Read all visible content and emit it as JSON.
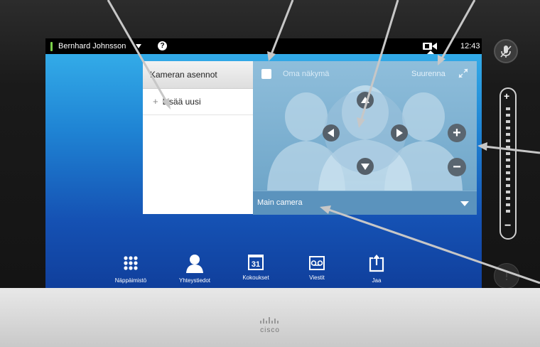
{
  "status_bar": {
    "user_name": "Bernhard Johnsson",
    "help_glyph": "?",
    "clock": "12:43",
    "status_color": "#7bd14a"
  },
  "presets_panel": {
    "title": "Kameran asennot",
    "add_plus": "+",
    "add_new": "Lisää uusi"
  },
  "camera_panel": {
    "own_view_label": "Oma näkymä",
    "zoom_label": "Suurenna",
    "zoom_in": "+",
    "zoom_out": "−",
    "source": "Main camera"
  },
  "dock": [
    {
      "label": "Näppäimistö",
      "icon": "keypad-icon"
    },
    {
      "label": "Yhteystiedot",
      "icon": "contacts-icon"
    },
    {
      "label": "Kokoukset",
      "icon": "calendar-icon",
      "date": "31"
    },
    {
      "label": "Viestit",
      "icon": "voicemail-icon"
    },
    {
      "label": "Jaa",
      "icon": "share-icon"
    }
  ],
  "side_controls": {
    "volume_plus": "+",
    "volume_minus": "−",
    "help": "!"
  },
  "brand": "cisco"
}
